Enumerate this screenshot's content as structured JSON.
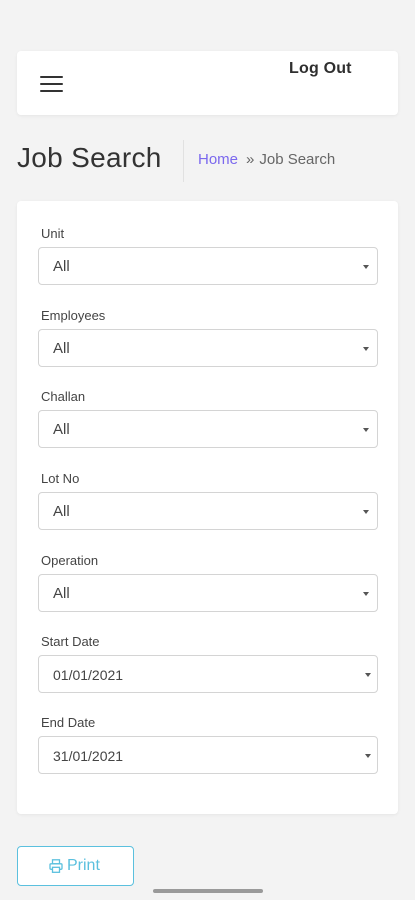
{
  "header": {
    "logout_label": "Log Out"
  },
  "page": {
    "title": "Job Search",
    "breadcrumb": {
      "home": "Home",
      "separator": "»",
      "current": "Job Search"
    }
  },
  "filters": [
    {
      "label": "Unit",
      "value": "All"
    },
    {
      "label": "Employees",
      "value": "All"
    },
    {
      "label": "Challan",
      "value": "All"
    },
    {
      "label": "Lot No",
      "value": "All"
    },
    {
      "label": "Operation",
      "value": "All"
    },
    {
      "label": "Start Date",
      "value": "01/01/2021"
    },
    {
      "label": "End Date",
      "value": "31/01/2021"
    }
  ],
  "actions": {
    "print_label": "Print",
    "print_icon": "printer-icon"
  },
  "colors": {
    "accent": "#7b68ee",
    "info": "#5bc0de",
    "background": "#f3f3f3"
  }
}
